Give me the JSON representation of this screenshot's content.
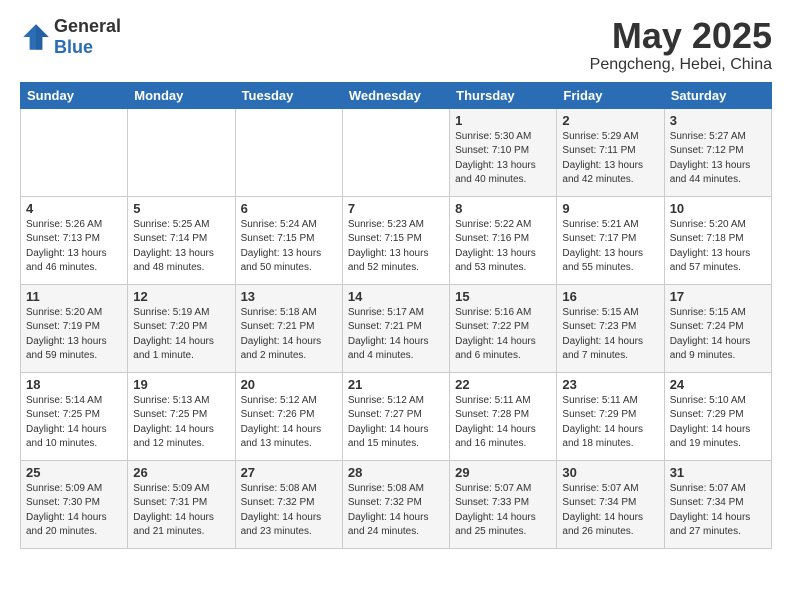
{
  "logo": {
    "general": "General",
    "blue": "Blue"
  },
  "title": {
    "month": "May 2025",
    "location": "Pengcheng, Hebei, China"
  },
  "weekdays": [
    "Sunday",
    "Monday",
    "Tuesday",
    "Wednesday",
    "Thursday",
    "Friday",
    "Saturday"
  ],
  "weeks": [
    [
      {
        "day": "",
        "info": ""
      },
      {
        "day": "",
        "info": ""
      },
      {
        "day": "",
        "info": ""
      },
      {
        "day": "",
        "info": ""
      },
      {
        "day": "1",
        "info": "Sunrise: 5:30 AM\nSunset: 7:10 PM\nDaylight: 13 hours\nand 40 minutes."
      },
      {
        "day": "2",
        "info": "Sunrise: 5:29 AM\nSunset: 7:11 PM\nDaylight: 13 hours\nand 42 minutes."
      },
      {
        "day": "3",
        "info": "Sunrise: 5:27 AM\nSunset: 7:12 PM\nDaylight: 13 hours\nand 44 minutes."
      }
    ],
    [
      {
        "day": "4",
        "info": "Sunrise: 5:26 AM\nSunset: 7:13 PM\nDaylight: 13 hours\nand 46 minutes."
      },
      {
        "day": "5",
        "info": "Sunrise: 5:25 AM\nSunset: 7:14 PM\nDaylight: 13 hours\nand 48 minutes."
      },
      {
        "day": "6",
        "info": "Sunrise: 5:24 AM\nSunset: 7:15 PM\nDaylight: 13 hours\nand 50 minutes."
      },
      {
        "day": "7",
        "info": "Sunrise: 5:23 AM\nSunset: 7:15 PM\nDaylight: 13 hours\nand 52 minutes."
      },
      {
        "day": "8",
        "info": "Sunrise: 5:22 AM\nSunset: 7:16 PM\nDaylight: 13 hours\nand 53 minutes."
      },
      {
        "day": "9",
        "info": "Sunrise: 5:21 AM\nSunset: 7:17 PM\nDaylight: 13 hours\nand 55 minutes."
      },
      {
        "day": "10",
        "info": "Sunrise: 5:20 AM\nSunset: 7:18 PM\nDaylight: 13 hours\nand 57 minutes."
      }
    ],
    [
      {
        "day": "11",
        "info": "Sunrise: 5:20 AM\nSunset: 7:19 PM\nDaylight: 13 hours\nand 59 minutes."
      },
      {
        "day": "12",
        "info": "Sunrise: 5:19 AM\nSunset: 7:20 PM\nDaylight: 14 hours\nand 1 minute."
      },
      {
        "day": "13",
        "info": "Sunrise: 5:18 AM\nSunset: 7:21 PM\nDaylight: 14 hours\nand 2 minutes."
      },
      {
        "day": "14",
        "info": "Sunrise: 5:17 AM\nSunset: 7:21 PM\nDaylight: 14 hours\nand 4 minutes."
      },
      {
        "day": "15",
        "info": "Sunrise: 5:16 AM\nSunset: 7:22 PM\nDaylight: 14 hours\nand 6 minutes."
      },
      {
        "day": "16",
        "info": "Sunrise: 5:15 AM\nSunset: 7:23 PM\nDaylight: 14 hours\nand 7 minutes."
      },
      {
        "day": "17",
        "info": "Sunrise: 5:15 AM\nSunset: 7:24 PM\nDaylight: 14 hours\nand 9 minutes."
      }
    ],
    [
      {
        "day": "18",
        "info": "Sunrise: 5:14 AM\nSunset: 7:25 PM\nDaylight: 14 hours\nand 10 minutes."
      },
      {
        "day": "19",
        "info": "Sunrise: 5:13 AM\nSunset: 7:25 PM\nDaylight: 14 hours\nand 12 minutes."
      },
      {
        "day": "20",
        "info": "Sunrise: 5:12 AM\nSunset: 7:26 PM\nDaylight: 14 hours\nand 13 minutes."
      },
      {
        "day": "21",
        "info": "Sunrise: 5:12 AM\nSunset: 7:27 PM\nDaylight: 14 hours\nand 15 minutes."
      },
      {
        "day": "22",
        "info": "Sunrise: 5:11 AM\nSunset: 7:28 PM\nDaylight: 14 hours\nand 16 minutes."
      },
      {
        "day": "23",
        "info": "Sunrise: 5:11 AM\nSunset: 7:29 PM\nDaylight: 14 hours\nand 18 minutes."
      },
      {
        "day": "24",
        "info": "Sunrise: 5:10 AM\nSunset: 7:29 PM\nDaylight: 14 hours\nand 19 minutes."
      }
    ],
    [
      {
        "day": "25",
        "info": "Sunrise: 5:09 AM\nSunset: 7:30 PM\nDaylight: 14 hours\nand 20 minutes."
      },
      {
        "day": "26",
        "info": "Sunrise: 5:09 AM\nSunset: 7:31 PM\nDaylight: 14 hours\nand 21 minutes."
      },
      {
        "day": "27",
        "info": "Sunrise: 5:08 AM\nSunset: 7:32 PM\nDaylight: 14 hours\nand 23 minutes."
      },
      {
        "day": "28",
        "info": "Sunrise: 5:08 AM\nSunset: 7:32 PM\nDaylight: 14 hours\nand 24 minutes."
      },
      {
        "day": "29",
        "info": "Sunrise: 5:07 AM\nSunset: 7:33 PM\nDaylight: 14 hours\nand 25 minutes."
      },
      {
        "day": "30",
        "info": "Sunrise: 5:07 AM\nSunset: 7:34 PM\nDaylight: 14 hours\nand 26 minutes."
      },
      {
        "day": "31",
        "info": "Sunrise: 5:07 AM\nSunset: 7:34 PM\nDaylight: 14 hours\nand 27 minutes."
      }
    ]
  ]
}
